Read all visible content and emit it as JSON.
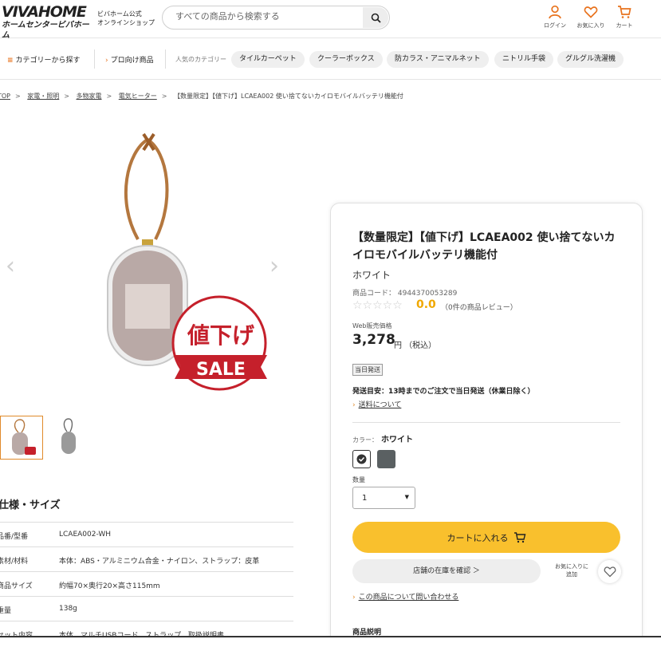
{
  "header": {
    "logo_top": "VIVAHOME",
    "logo_bottom_a": "ホームセンター",
    "logo_bottom_b": "ビバホーム",
    "brand_line1": "ビバホーム公式",
    "brand_line2": "オンラインショップ",
    "search_placeholder": "すべての商品から検索する",
    "icons": [
      {
        "name": "user-icon",
        "label": "ログイン"
      },
      {
        "name": "heart-icon",
        "label": "お気に入り"
      },
      {
        "name": "cart-icon",
        "label": "カート"
      }
    ],
    "accent": "#e8731e"
  },
  "nav": {
    "category": "カテゴリーから探す",
    "pro": "プロ向け商品",
    "popular_label": "人気のカテゴリー",
    "chips": [
      "タイルカーペット",
      "クーラーボックス",
      "防カラス・アニマルネット",
      "ニトリル手袋",
      "グルグル洗濯機"
    ]
  },
  "breadcrumb": [
    "TOP",
    "家電・照明",
    "多物家電",
    "電気ヒーター",
    "【数量限定】【値下げ】LCAEA002 使い捨てないカイロモバイルバッテリ機能付"
  ],
  "gallery": {
    "sale_text_top": "値下げ",
    "sale_text_bottom": "SALE"
  },
  "specs": {
    "title": "仕様・サイズ",
    "rows": [
      {
        "k": "品番/型番",
        "v": "LCAEA002-WH"
      },
      {
        "k": "素材/材料",
        "v": "本体：ABS・アルミニウム合金・ナイロン、ストラップ：皮革"
      },
      {
        "k": "商品サイズ",
        "v": "約幅70×奥行20×高さ115mm"
      },
      {
        "k": "重量",
        "v": "138g"
      },
      {
        "k": "セット内容",
        "v": "本体、マルチUSBコード、ストラップ、取扱説明書"
      }
    ]
  },
  "product": {
    "title": "【数量限定】【値下げ】LCAEA002 使い捨てないカイロモバイルバッテリ機能付",
    "variant": "ホワイト",
    "code": "商品コード： 4944370053289",
    "stars": "☆☆☆☆☆",
    "rating": "0.0",
    "reviews": "（0件の商品レビュー）",
    "price_label": "Web販売価格",
    "price": "3,278",
    "price_unit": "円 （税込）",
    "badge": "当日発送",
    "ship_note": "発送目安：13時までのご注文で当日発送（休業日除く）",
    "ship_link": "送料について",
    "color_label": "カラー：",
    "color_value": "ホワイト",
    "swatches": [
      "#3a3a3a",
      "#5a6062"
    ],
    "qty_label": "数量",
    "qty_value": "1",
    "cart_button": "カートに入れる",
    "store_button": "店舗の在庫を確認 ＞",
    "fav_label1": "お気に入りに",
    "fav_label2": "追加",
    "inquiry": "この商品について問い合わせる",
    "desc_label": "商品説明",
    "cart_color": "#f9c02d"
  }
}
